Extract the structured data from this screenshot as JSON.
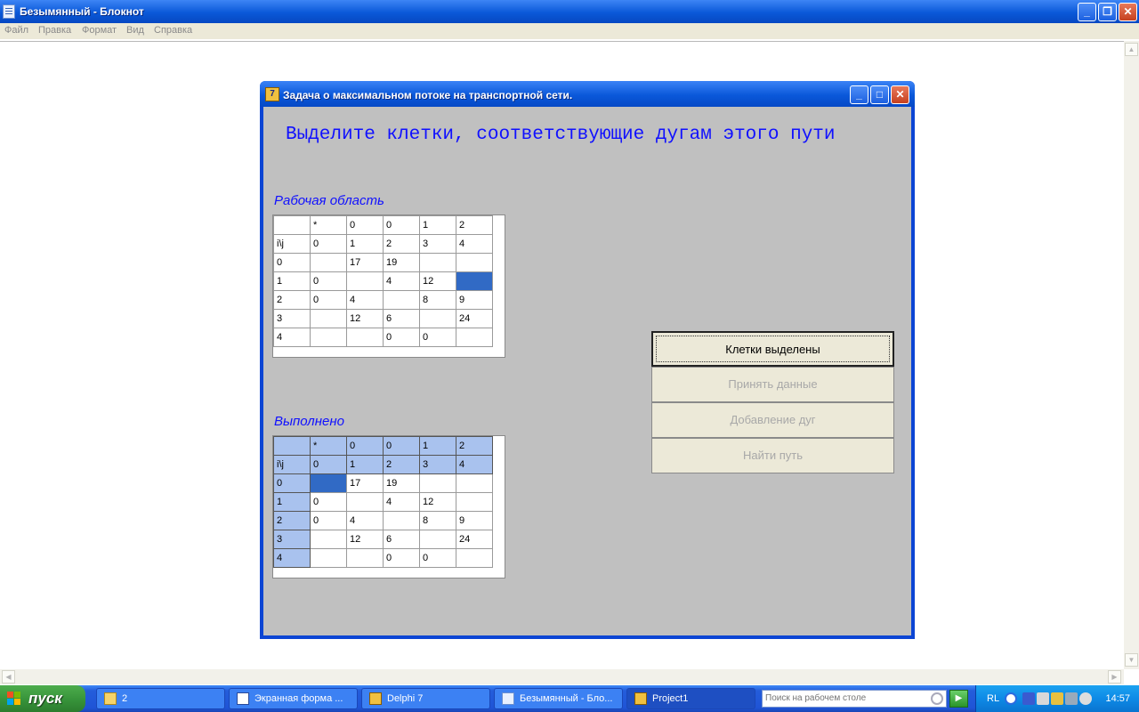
{
  "notepad": {
    "title": "Безымянный - Блокнот",
    "menu": [
      "Файл",
      "Правка",
      "Формат",
      "Вид",
      "Справка"
    ],
    "buttons": {
      "minimize": "_",
      "restore": "❐",
      "close": "✕"
    }
  },
  "app": {
    "title": "Задача о максимальном потоке на транспортной сети.",
    "instruction": "Выделите клетки, соответствующие дугам этого пути",
    "work_caption": "Рабочая область",
    "done_caption": "Выполнено",
    "work_grid": [
      [
        "",
        "*",
        "0",
        "0",
        "1",
        "2"
      ],
      [
        "i\\j",
        "0",
        "1",
        "2",
        "3",
        "4"
      ],
      [
        "0",
        "",
        "17",
        "19",
        "",
        ""
      ],
      [
        "1",
        "0",
        "",
        "4",
        "12",
        ""
      ],
      [
        "2",
        "0",
        "4",
        "",
        "8",
        "9"
      ],
      [
        "3",
        "",
        "12",
        "6",
        "",
        "24"
      ],
      [
        "4",
        "",
        "",
        "0",
        "0",
        ""
      ]
    ],
    "done_grid": [
      [
        "",
        "*",
        "0",
        "0",
        "1",
        "2"
      ],
      [
        "i\\j",
        "0",
        "1",
        "2",
        "3",
        "4"
      ],
      [
        "0",
        "",
        "17",
        "19",
        "",
        ""
      ],
      [
        "1",
        "0",
        "",
        "4",
        "12",
        ""
      ],
      [
        "2",
        "0",
        "4",
        "",
        "8",
        "9"
      ],
      [
        "3",
        "",
        "12",
        "6",
        "",
        "24"
      ],
      [
        "4",
        "",
        "",
        "0",
        "0",
        ""
      ]
    ],
    "buttons": {
      "cells_selected": "Клетки выделены",
      "accept_data": "Принять данные",
      "add_arcs": "Добавление дуг",
      "find_path": "Найти путь"
    }
  },
  "taskbar": {
    "start": "пуск",
    "tasks": [
      {
        "label": "2",
        "icon": "folder-icon"
      },
      {
        "label": "Экранная форма ...",
        "icon": "word-icon"
      },
      {
        "label": "Delphi 7",
        "icon": "delphi-icon"
      },
      {
        "label": "Безымянный - Бло...",
        "icon": "notepad-icon"
      },
      {
        "label": "Project1",
        "icon": "delphi-icon"
      }
    ],
    "search_placeholder": "Поиск на рабочем столе",
    "lang": "RL",
    "clock": "14:57"
  },
  "colors": {
    "selected_cell": "#316ac5",
    "fixed_cell": "#a9c2ee",
    "accent_text": "#1010ff",
    "client_bg": "#c0c0c0"
  }
}
